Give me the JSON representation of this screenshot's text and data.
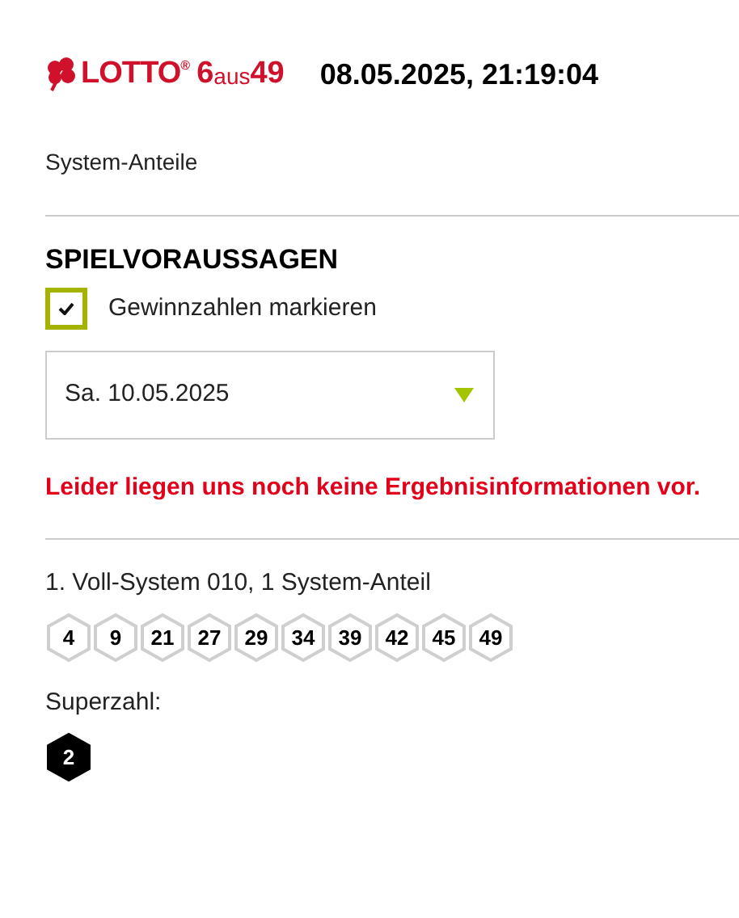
{
  "header": {
    "logo": {
      "brand": "LOTTO",
      "registered": "®",
      "game_number": "6",
      "game_word": "aus",
      "game_max": "49"
    },
    "datetime": "08.05.2025, 21:19:04"
  },
  "section_label": "System-Anteile",
  "heading": "SPIELVORAUSSAGEN",
  "checkbox": {
    "label": "Gewinnzahlen markieren",
    "checked": true
  },
  "date_select": {
    "value": "Sa. 10.05.2025"
  },
  "error_message": "Leider liegen uns noch keine Ergebnisinformationen vor.",
  "system": {
    "title": "1. Voll-System 010, 1 System-Anteil",
    "numbers": [
      "4",
      "9",
      "21",
      "27",
      "29",
      "34",
      "39",
      "42",
      "45",
      "49"
    ],
    "superzahl_label": "Superzahl:",
    "superzahl": "2"
  }
}
